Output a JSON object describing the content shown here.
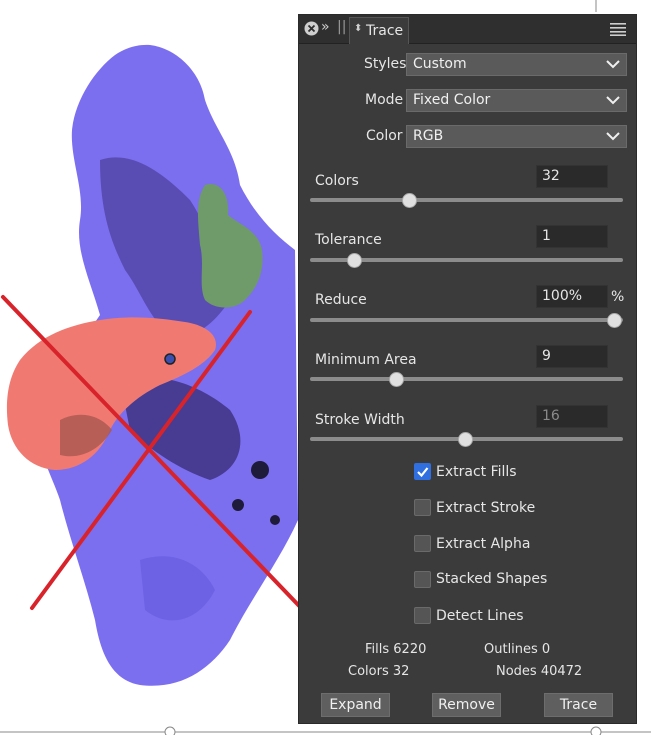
{
  "panel": {
    "tab_label": "Trace",
    "styles": {
      "label": "Styles",
      "value": "Custom"
    },
    "mode": {
      "label": "Mode",
      "value": "Fixed Color"
    },
    "color": {
      "label": "Color",
      "value": "RGB"
    },
    "sliders": {
      "colors": {
        "label": "Colors",
        "value": "32",
        "fraction": 0.32
      },
      "tolerance": {
        "label": "Tolerance",
        "value": "1",
        "fraction": 0.14
      },
      "reduce": {
        "label": "Reduce",
        "value": "100%",
        "unit": "%",
        "fraction": 1.0
      },
      "minimum_area": {
        "label": "Minimum Area",
        "value": "9",
        "fraction": 0.28
      },
      "stroke_width": {
        "label": "Stroke Width",
        "value": "16",
        "fraction": 0.5
      }
    },
    "checkboxes": {
      "extract_fills": {
        "label": "Extract Fills",
        "checked": true
      },
      "extract_stroke": {
        "label": "Extract Stroke",
        "checked": false
      },
      "extract_alpha": {
        "label": "Extract Alpha",
        "checked": false
      },
      "stacked_shapes": {
        "label": "Stacked Shapes",
        "checked": false
      },
      "detect_lines": {
        "label": "Detect Lines",
        "checked": false
      }
    },
    "stats": {
      "fills": "Fills 6220",
      "outlines": "Outlines 0",
      "colors": "Colors 32",
      "nodes": "Nodes 40472"
    },
    "buttons": {
      "expand": "Expand",
      "remove": "Remove",
      "trace": "Trace"
    }
  },
  "colors": {
    "panel_bg": "#3b3b3b",
    "protein_blue": "#7b6ff0",
    "protein_dark": "#3b2f7a",
    "protein_salmon": "#f07a72",
    "protein_green": "#6f9a6a",
    "annotation_red": "#d8232a",
    "check_blue": "#2f6fe0"
  }
}
